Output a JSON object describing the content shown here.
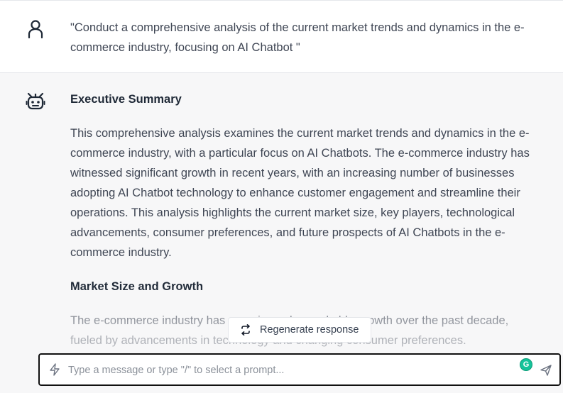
{
  "user_message": {
    "text": "\"Conduct a comprehensive analysis of the current market trends and dynamics in the e-commerce industry, focusing on AI Chatbot \"",
    "avatar_icon": "user-icon"
  },
  "bot_message": {
    "avatar_icon": "robot-icon",
    "sections": [
      {
        "heading": "Executive Summary",
        "body": "This comprehensive analysis examines the current market trends and dynamics in the e-commerce industry, with a particular focus on AI Chatbots. The e-commerce industry has witnessed significant growth in recent years, with an increasing number of businesses adopting AI Chatbot technology to enhance customer engagement and streamline their operations. This analysis highlights the current market size, key players, technological advancements, consumer preferences, and future prospects of AI Chatbots in the e-commerce industry."
      },
      {
        "heading": "Market Size and Growth",
        "body": "The e-commerce industry has experienced remarkable growth over the past decade, fueled by advancements in technology and changing consumer preferences."
      }
    ]
  },
  "regenerate": {
    "label": "Regenerate response",
    "icon": "refresh-icon"
  },
  "composer": {
    "placeholder": "Type a message or type \"/\" to select a prompt...",
    "value": "",
    "left_icon": "bolt-icon",
    "grammarly_label": "G",
    "send_icon": "send-icon"
  },
  "colors": {
    "user_bg": "#ffffff",
    "bot_bg": "#f7f7f8",
    "grammarly": "#15c39a",
    "input_border": "#111111"
  }
}
